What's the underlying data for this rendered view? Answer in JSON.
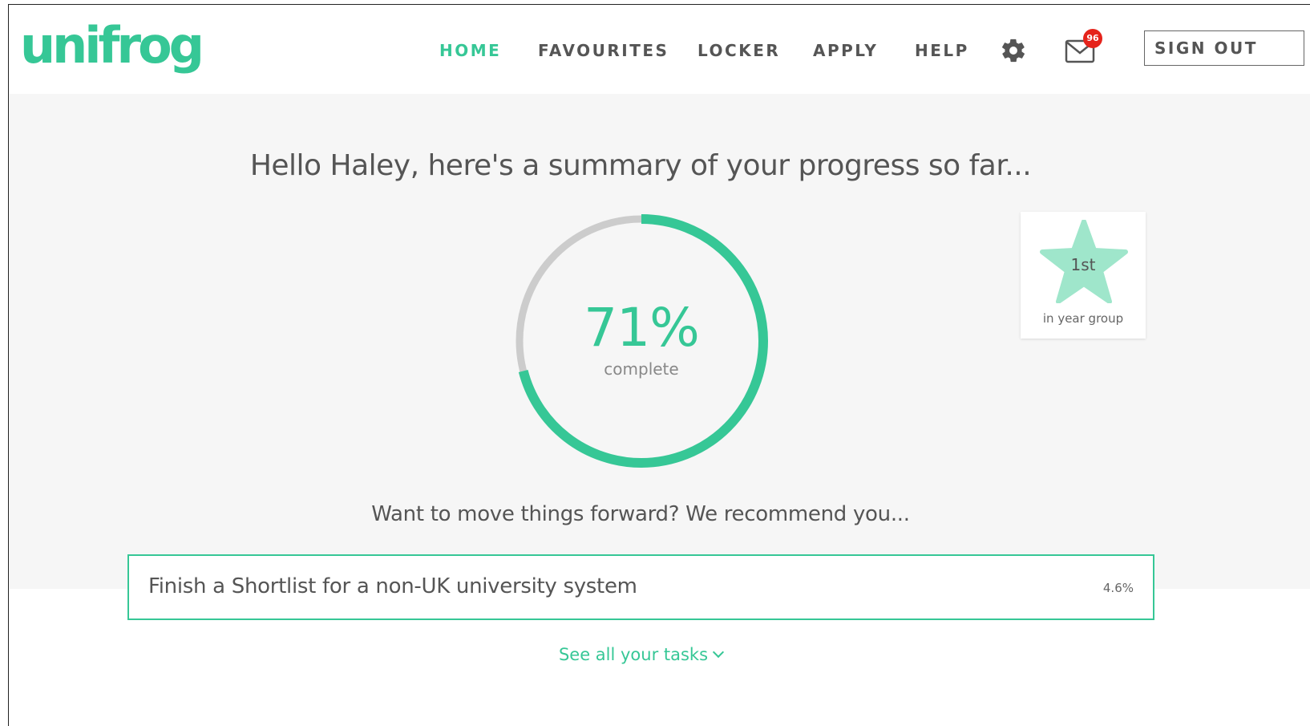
{
  "header": {
    "logo_text": "unifrog",
    "nav": [
      {
        "label": "HOME",
        "active": true
      },
      {
        "label": "FAVOURITES",
        "active": false
      },
      {
        "label": "LOCKER",
        "active": false
      },
      {
        "label": "APPLY",
        "active": false
      },
      {
        "label": "HELP",
        "active": false
      }
    ],
    "settings_icon": "gear-icon",
    "mail_icon": "envelope-icon",
    "mail_badge": "96",
    "sign_out": "SIGN OUT"
  },
  "summary": {
    "greeting": "Hello Haley, here's a summary of your progress so far...",
    "progress_percent": 71,
    "progress_text": "71%",
    "progress_label": "complete",
    "rank": {
      "value": "1st",
      "label": "in year group",
      "icon": "star-icon"
    },
    "recommend_text": "Want to move things forward? We recommend you...",
    "task": {
      "title": "Finish a Shortlist for a non-UK university system",
      "percent": "4.6%"
    },
    "see_all": "See all your tasks"
  },
  "colors": {
    "accent": "#36c796",
    "track": "#cccccc",
    "badge": "#e5231b",
    "panel_bg": "#f6f6f6",
    "text": "#555555"
  }
}
